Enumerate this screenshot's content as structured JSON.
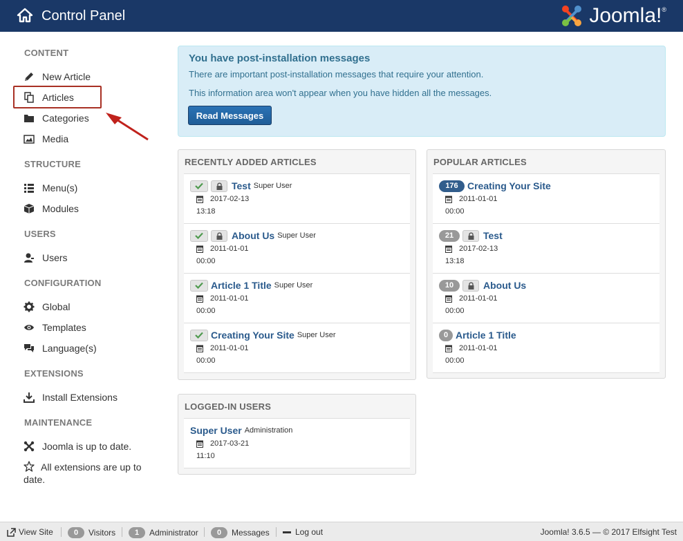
{
  "header": {
    "title": "Control Panel",
    "logo_text": "Joomla!",
    "logo_mark": "®"
  },
  "sidebar": {
    "sections": [
      {
        "heading": "CONTENT",
        "items": [
          {
            "label": "New Article",
            "icon": "pencil-icon"
          },
          {
            "label": "Articles",
            "icon": "copy-icon"
          },
          {
            "label": "Categories",
            "icon": "folder-icon"
          },
          {
            "label": "Media",
            "icon": "image-icon"
          }
        ]
      },
      {
        "heading": "STRUCTURE",
        "items": [
          {
            "label": "Menu(s)",
            "icon": "list-icon"
          },
          {
            "label": "Modules",
            "icon": "cube-icon"
          }
        ]
      },
      {
        "heading": "USERS",
        "items": [
          {
            "label": "Users",
            "icon": "user-icon"
          }
        ]
      },
      {
        "heading": "CONFIGURATION",
        "items": [
          {
            "label": "Global",
            "icon": "gear-icon"
          },
          {
            "label": "Templates",
            "icon": "eye-icon"
          },
          {
            "label": "Language(s)",
            "icon": "comments-icon"
          }
        ]
      },
      {
        "heading": "EXTENSIONS",
        "items": [
          {
            "label": "Install Extensions",
            "icon": "download-icon"
          }
        ]
      },
      {
        "heading": "MAINTENANCE",
        "items": [
          {
            "label": "Joomla is up to date.",
            "icon": "joomla-icon"
          },
          {
            "label": "All extensions are up to date.",
            "icon": "star-icon"
          }
        ]
      }
    ]
  },
  "alert": {
    "title": "You have post-installation messages",
    "line1": "There are important post-installation messages that require your attention.",
    "line2": "This information area won't appear when you have hidden all the messages.",
    "button": "Read Messages"
  },
  "recent": {
    "heading": "RECENTLY ADDED ARTICLES",
    "rows": [
      {
        "title": "Test",
        "author": "Super User",
        "date": "2017-02-13",
        "time": "13:18",
        "locked": true
      },
      {
        "title": "About Us",
        "author": "Super User",
        "date": "2011-01-01",
        "time": "00:00",
        "locked": true
      },
      {
        "title": "Article 1 Title",
        "author": "Super User",
        "date": "2011-01-01",
        "time": "00:00",
        "locked": false
      },
      {
        "title": "Creating Your Site",
        "author": "Super User",
        "date": "2011-01-01",
        "time": "00:00",
        "locked": false
      }
    ]
  },
  "popular": {
    "heading": "POPULAR ARTICLES",
    "rows": [
      {
        "hits": "176",
        "title": "Creating Your Site",
        "date": "2011-01-01",
        "time": "00:00",
        "locked": false
      },
      {
        "hits": "21",
        "title": "Test",
        "date": "2017-02-13",
        "time": "13:18",
        "locked": true
      },
      {
        "hits": "10",
        "title": "About Us",
        "date": "2011-01-01",
        "time": "00:00",
        "locked": true
      },
      {
        "hits": "0",
        "title": "Article 1 Title",
        "date": "2011-01-01",
        "time": "00:00",
        "locked": false
      }
    ]
  },
  "logged": {
    "heading": "LOGGED-IN USERS",
    "rows": [
      {
        "name": "Super User",
        "role": "Administration",
        "date": "2017-03-21",
        "time": "11:10"
      }
    ]
  },
  "footer": {
    "view_site": "View Site",
    "visitors_count": "0",
    "visitors": "Visitors",
    "admin_count": "1",
    "admin": "Administrator",
    "messages_count": "0",
    "messages": "Messages",
    "logout": "Log out",
    "copyright": "Joomla! 3.6.5 — © 2017 Elfsight Test"
  },
  "colors": {
    "header_bg": "#1a3867",
    "link": "#2a5a8c",
    "alert_bg": "#d9edf7",
    "highlight": "#a83024"
  }
}
